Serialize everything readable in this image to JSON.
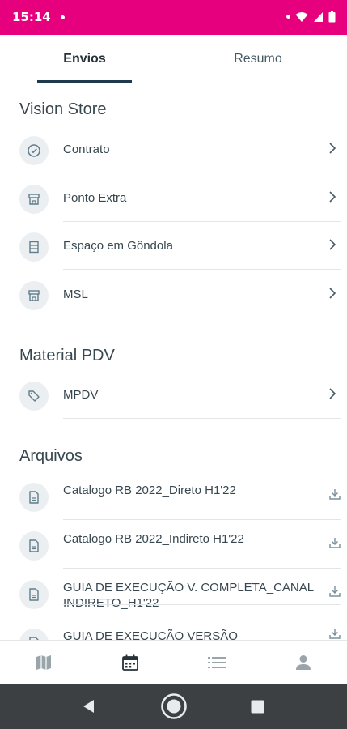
{
  "status_bar": {
    "time": "15:14",
    "background": "#e6007e"
  },
  "tabs": [
    {
      "label": "Envios",
      "selected": true
    },
    {
      "label": "Resumo",
      "selected": false
    }
  ],
  "sections": {
    "vision_store": {
      "title": "Vision Store",
      "items": [
        {
          "label": "Contrato",
          "icon": "check-circle-icon"
        },
        {
          "label": "Ponto Extra",
          "icon": "store-icon"
        },
        {
          "label": "Espaço em Gôndola",
          "icon": "shelf-icon"
        },
        {
          "label": "MSL",
          "icon": "store-icon"
        }
      ]
    },
    "material_pdv": {
      "title": "Material PDV",
      "items": [
        {
          "label": "MPDV",
          "icon": "tag-icon"
        }
      ]
    },
    "arquivos": {
      "title": "Arquivos",
      "items": [
        {
          "label": "Catalogo RB 2022_Direto H1'22",
          "icon": "file-icon"
        },
        {
          "label": "Catalogo RB 2022_Indireto H1'22",
          "icon": "file-icon"
        },
        {
          "label": "GUIA DE EXECUÇÃO V. COMPLETA_CANAL INDIRETO_H1'22",
          "icon": "file-icon"
        },
        {
          "label": "GUIA DE EXECUÇÃO VERSÃO",
          "icon": "file-icon"
        }
      ]
    }
  },
  "bottom_nav": [
    "map-icon",
    "calendar-icon",
    "list-icon",
    "person-icon"
  ],
  "colors": {
    "accent": "#e6007e",
    "tab_indicator": "#1f3a4d",
    "text": "#37474f",
    "icon_bg": "#eceff1"
  }
}
